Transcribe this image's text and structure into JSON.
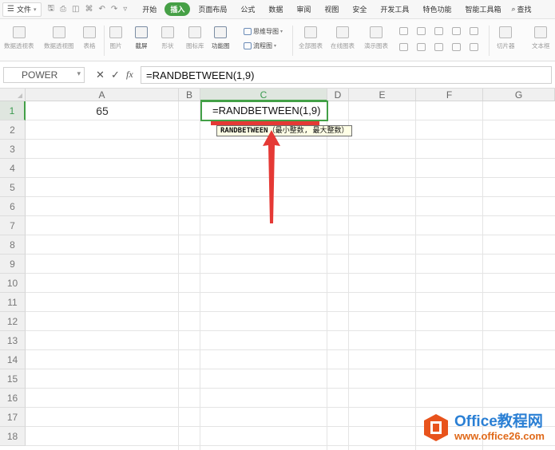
{
  "menubar": {
    "file_label": "文件",
    "items": [
      "开始",
      "插入",
      "页面布局",
      "公式",
      "数据",
      "审阅",
      "视图",
      "安全",
      "开发工具",
      "特色功能",
      "智能工具箱"
    ],
    "active_index": 1,
    "search_label": "查找",
    "accent_color": "#46a046"
  },
  "ribbon": {
    "large_buttons": [
      "数据透视表",
      "数据透视图",
      "表格",
      "图片",
      "截屏",
      "形状",
      "图标库",
      "功能图",
      "全部图表",
      "在线图表",
      "演示图表",
      "切片器",
      "文本框"
    ],
    "small_buttons": [
      "思维导图",
      "流程图"
    ]
  },
  "formula_bar": {
    "name_box": "POWER",
    "cancel_icon": "close-icon",
    "confirm_icon": "check-icon",
    "fx_label": "fx",
    "formula": "=RANDBETWEEN(1,9)"
  },
  "grid": {
    "columns": [
      "A",
      "B",
      "C",
      "D",
      "E",
      "F",
      "G"
    ],
    "selected_column": "C",
    "rows": [
      "1",
      "2",
      "3",
      "4",
      "5",
      "6",
      "7",
      "8",
      "9",
      "10",
      "11",
      "12",
      "13",
      "14",
      "15",
      "16",
      "17",
      "18"
    ],
    "selected_row": "1",
    "cell_a1": "65",
    "cell_c1": "=RANDBETWEEN(1,9)"
  },
  "tooltip": {
    "function_name": "RANDBETWEEN",
    "args": "（最小整数, 最大整数）"
  },
  "watermark": {
    "brand": "Office教程网",
    "url": "www.office26.com"
  }
}
